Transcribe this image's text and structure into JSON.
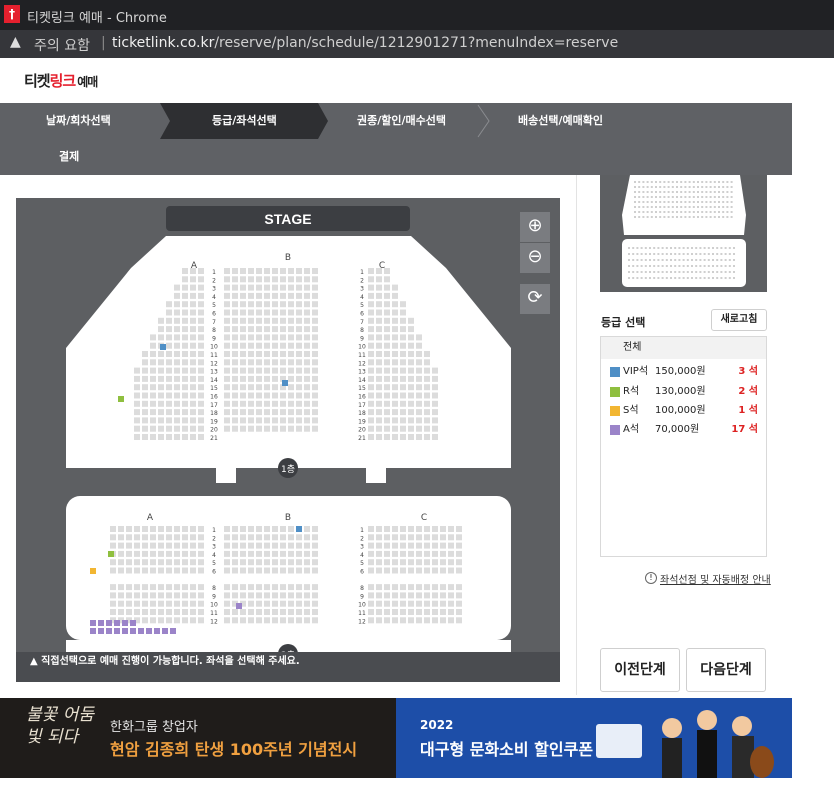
{
  "browser": {
    "app": "Chrome",
    "tab_title": "티켓링크 예매 - Chrome",
    "favicon_glyph": "†",
    "security_text": "주의 요함",
    "url_domain": "ticketlink.co.kr",
    "url_path": "/reserve/plan/schedule/1212901271?menuIndex=reserve"
  },
  "logo": {
    "part1": "티켓",
    "part2": "링크",
    "part3": "예매"
  },
  "steps": [
    {
      "label": "날짜/회차선택",
      "active": false
    },
    {
      "label": "등급/좌석선택",
      "active": true
    },
    {
      "label": "권종/할인/매수선택",
      "active": false
    },
    {
      "label": "배송선택/예매확인",
      "active": false
    },
    {
      "label": "결제",
      "active": false
    }
  ],
  "seatmap": {
    "stage_label": "STAGE",
    "floor1_label": "1층",
    "floor2_label": "2층",
    "section_labels": [
      "A",
      "B",
      "C"
    ],
    "floor1_rows": [
      "1",
      "2",
      "3",
      "4",
      "5",
      "6",
      "7",
      "8",
      "9",
      "10",
      "11",
      "12",
      "13",
      "14",
      "15",
      "16",
      "17",
      "18",
      "19",
      "20",
      "21"
    ],
    "floor2_rows": [
      "1",
      "2",
      "3",
      "4",
      "5",
      "6",
      "",
      "8",
      "9",
      "10",
      "11",
      "12"
    ],
    "notice": "직접선택으로 예매 진행이 가능합니다. 좌석을 선택해 주세요.",
    "zoom_in_icon": "zoom-in-icon",
    "zoom_out_icon": "zoom-out-icon",
    "reset_icon": "refresh-icon"
  },
  "grades": {
    "title": "등급 선택",
    "refresh_label": "새로고침",
    "all_label": "전체",
    "items": [
      {
        "name": "VIP석",
        "price": "150,000원",
        "count": "3 석",
        "color": "#4f8fc6"
      },
      {
        "name": "R석",
        "price": "130,000원",
        "count": "2 석",
        "color": "#8fbf3f"
      },
      {
        "name": "S석",
        "price": "100,000원",
        "count": "1 석",
        "color": "#f2b632"
      },
      {
        "name": "A석",
        "price": "70,000원",
        "count": "17 석",
        "color": "#9b84c9"
      }
    ]
  },
  "guide_link": "좌석선점 및 자동배정 안내",
  "guide_icon": "info-icon",
  "buttons": {
    "prev": "이전단계",
    "next": "다음단계"
  },
  "banners": {
    "left_art": "불꽃 어둠빛 되다",
    "left_line1": "한화그룹 창업자",
    "left_line2_highlight": "현암 김종희 탄생 100주년",
    "left_line2_rest": " 기념전시",
    "right_year": "2022",
    "right_text": "대구형 문화소비 할인쿠폰"
  }
}
